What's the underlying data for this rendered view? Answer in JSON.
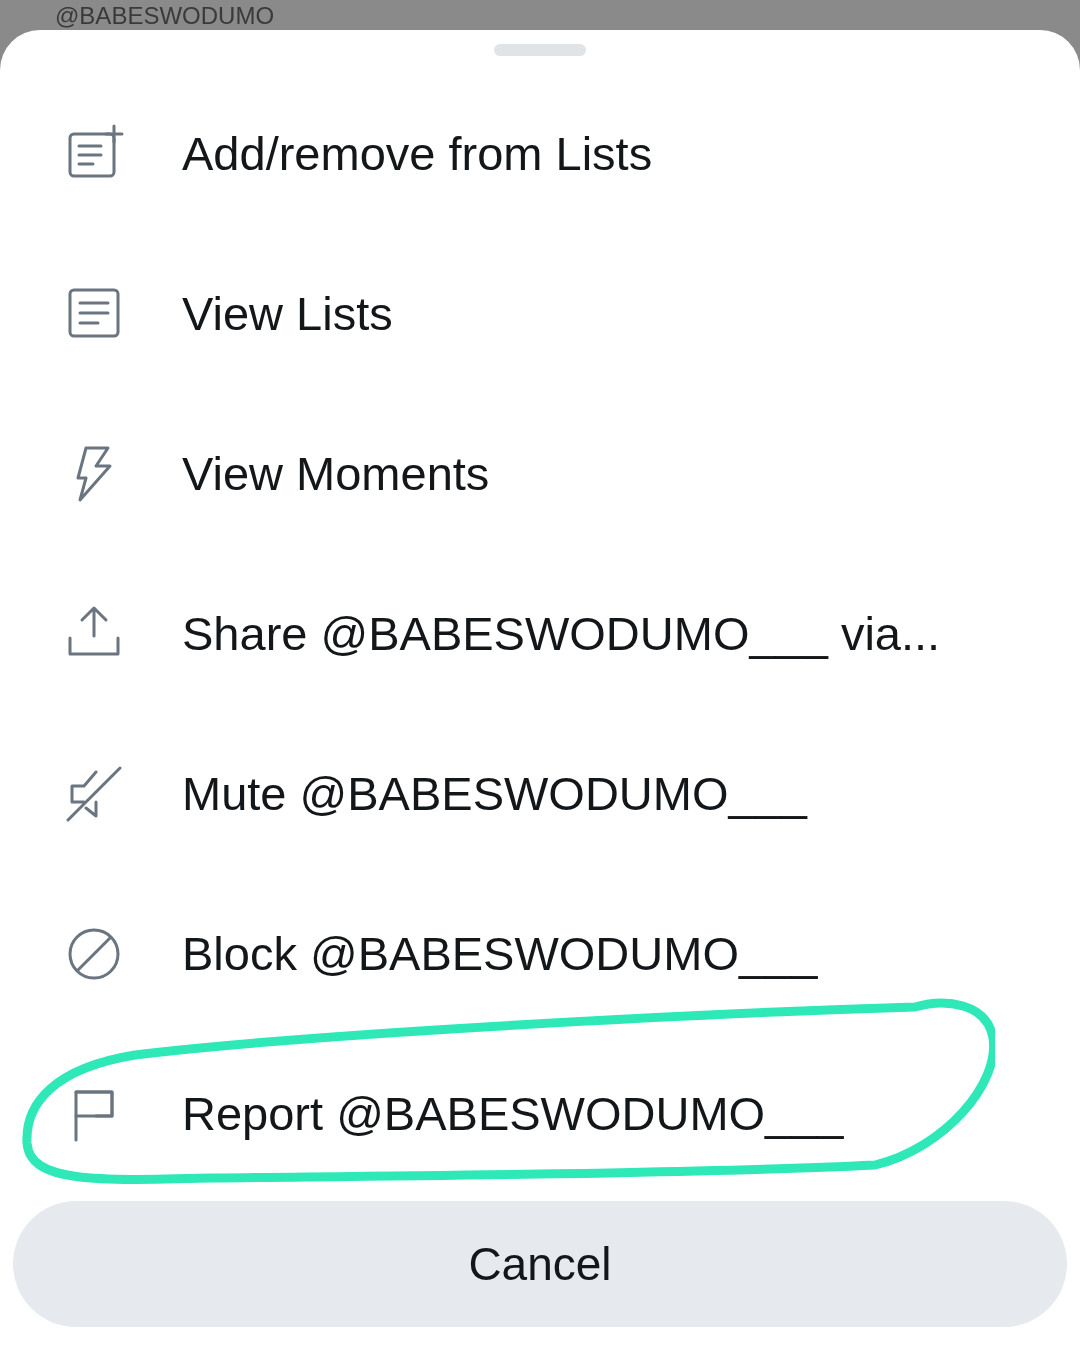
{
  "background": {
    "handle": "@BABESWODUMO"
  },
  "menu": [
    {
      "kind": "list-add",
      "label": "Add/remove from Lists",
      "circled": false
    },
    {
      "kind": "list",
      "label": "View Lists",
      "circled": false
    },
    {
      "kind": "bolt",
      "label": "View Moments",
      "circled": false
    },
    {
      "kind": "share",
      "label": "Share @BABESWODUMO___ via...",
      "circled": false
    },
    {
      "kind": "mute",
      "label": "Mute @BABESWODUMO___",
      "circled": false
    },
    {
      "kind": "block",
      "label": "Block @BABESWODUMO___",
      "circled": false
    },
    {
      "kind": "flag",
      "label": "Report @BABESWODUMO___",
      "circled": true
    }
  ],
  "cancel": "Cancel"
}
